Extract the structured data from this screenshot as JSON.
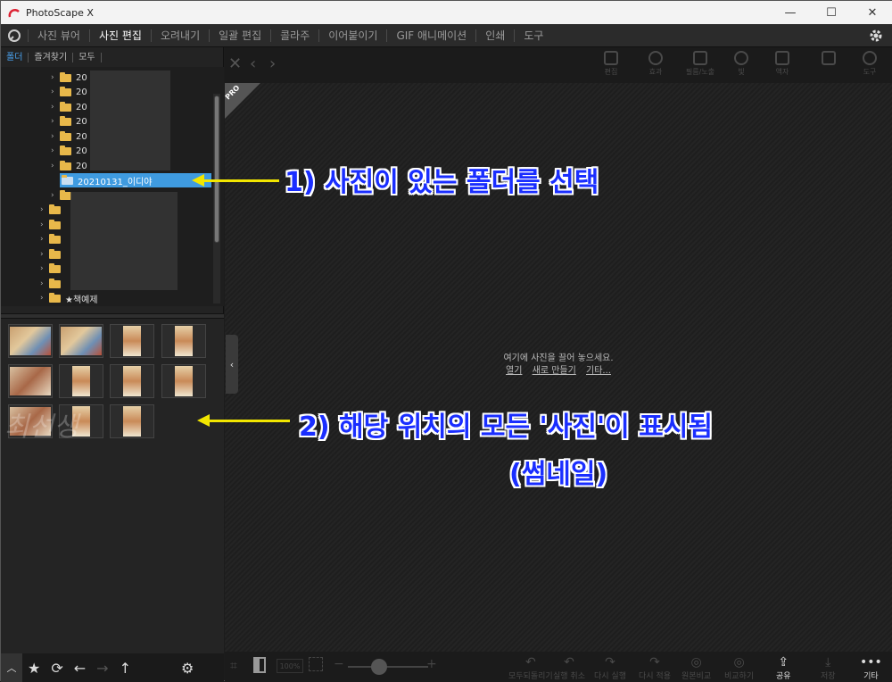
{
  "window": {
    "title": "PhotoScape X",
    "minimize": "—",
    "maximize": "☐",
    "close": "✕"
  },
  "menu": {
    "tabs": [
      {
        "label": "사진 뷰어",
        "active": false
      },
      {
        "label": "사진 편집",
        "active": true
      },
      {
        "label": "오려내기",
        "active": false
      },
      {
        "label": "일괄 편집",
        "active": false
      },
      {
        "label": "콜라주",
        "active": false
      },
      {
        "label": "이어붙이기",
        "active": false
      },
      {
        "label": "GIF 애니메이션",
        "active": false
      },
      {
        "label": "인쇄",
        "active": false
      },
      {
        "label": "도구",
        "active": false
      }
    ]
  },
  "left_panel": {
    "subtabs": [
      "폴더",
      "즐겨찾기",
      "모두"
    ],
    "tree": {
      "year_rows": [
        "20",
        "20",
        "20",
        "20",
        "20",
        "20",
        "20"
      ],
      "selected": "20210131_이디야",
      "last_folder": "★책예제"
    },
    "signature": "최선생"
  },
  "bottom_icons": [
    "chevron-up-icon",
    "star-icon",
    "refresh-icon",
    "arrow-left-icon",
    "arrow-right-icon",
    "arrow-up-icon",
    "gear-icon"
  ],
  "main": {
    "pro_badge": "PRO",
    "drop_message": "여기에 사진을 끌어 놓으세요.",
    "links": {
      "open": "열기",
      "new": "새로 만들기",
      "more": "기타..."
    }
  },
  "top_tools": [
    "편집",
    "효과",
    "필름/노출",
    "빛",
    "액자",
    "",
    "도구"
  ],
  "bottom_toolbar": {
    "zoom": "100%",
    "buttons": [
      {
        "label": "모두되돌리기",
        "glyph": "↶"
      },
      {
        "label": "실행 취소",
        "glyph": "↶"
      },
      {
        "label": "다시 실행",
        "glyph": "↷"
      },
      {
        "label": "다시 적용",
        "glyph": "↷"
      },
      {
        "label": "원본비교",
        "glyph": "◎"
      },
      {
        "label": "비교하기",
        "glyph": "◎"
      },
      {
        "label": "공유",
        "glyph": "⇪",
        "active": true
      },
      {
        "label": "저장",
        "glyph": "⤓"
      },
      {
        "label": "기타",
        "glyph": "•••",
        "active": true
      }
    ]
  },
  "annotations": {
    "step1": "1) 사진이 있는 폴더를 선택",
    "step2_line1": "2) 해당 위치의 모든 '사진'이 표시됨",
    "step2_line2": "(썸네일)",
    "arrow_color": "#f2e600",
    "text_color": "#1a2eff"
  }
}
